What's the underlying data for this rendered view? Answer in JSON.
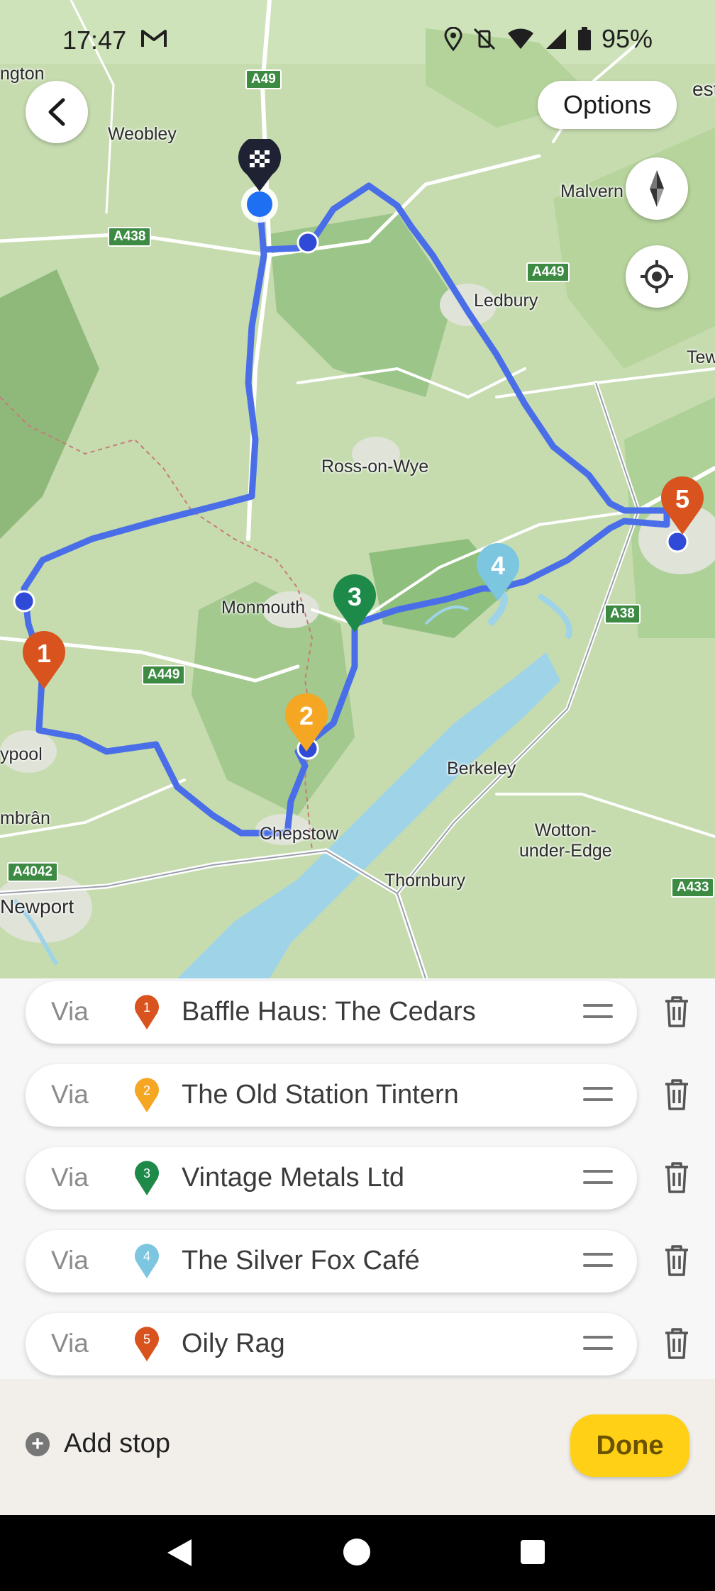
{
  "status_bar": {
    "time": "17:47",
    "battery": "95%"
  },
  "map": {
    "places": [
      "ngton",
      "Weobley",
      "Malvern",
      "Ledbury",
      "Tew",
      "Ross-on-Wye",
      "Monmouth",
      "Berkeley",
      "ypool",
      "mbrân",
      "Chepstow",
      "Wotton-\nunder-Edge",
      "Thornbury",
      "Newport",
      "est"
    ],
    "roads": [
      "A49",
      "A438",
      "A449",
      "A449",
      "A38",
      "A4042",
      "A433"
    ],
    "markers": [
      "1",
      "2",
      "3",
      "4",
      "5"
    ],
    "route_color": "#4a6ee8",
    "colors": {
      "stop1": "#d9531e",
      "stop2": "#f5a623",
      "stop3": "#1e8a4a",
      "stop4": "#7cc6df",
      "stop5": "#d9531e",
      "destination": "#1e2233"
    }
  },
  "controls": {
    "back": "back",
    "options": "Options",
    "compass": "compass",
    "locate": "locate"
  },
  "stops": [
    {
      "prefix": "Via",
      "number": "1",
      "name": "Baffle Haus: The Cedars",
      "color": "#d9531e"
    },
    {
      "prefix": "Via",
      "number": "2",
      "name": "The Old Station Tintern",
      "color": "#f5a623"
    },
    {
      "prefix": "Via",
      "number": "3",
      "name": "Vintage Metals Ltd",
      "color": "#1e8a4a"
    },
    {
      "prefix": "Via",
      "number": "4",
      "name": "The Silver Fox Café",
      "color": "#7cc6df"
    },
    {
      "prefix": "Via",
      "number": "5",
      "name": "Oily Rag",
      "color": "#d9531e"
    }
  ],
  "bottom": {
    "add_stop": "Add stop",
    "done": "Done"
  }
}
